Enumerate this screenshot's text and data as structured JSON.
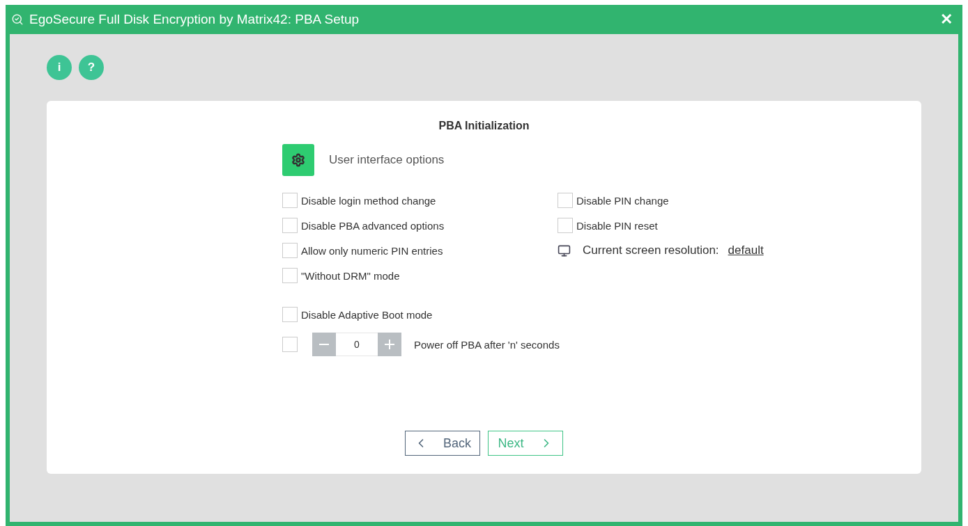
{
  "window": {
    "title": "EgoSecure Full Disk Encryption by Matrix42: PBA Setup",
    "close": "✕"
  },
  "header_buttons": [
    {
      "label": "i"
    },
    {
      "label": "?"
    }
  ],
  "page": {
    "title": "PBA Initialization",
    "section": "User interface options"
  },
  "left_options": [
    {
      "kind": "checkbox",
      "label": "Disable login method change",
      "checked": false
    },
    {
      "kind": "checkbox",
      "label": "Disable PBA advanced options",
      "checked": false
    },
    {
      "kind": "checkbox",
      "label": "Allow only numeric PIN entries",
      "checked": false
    },
    {
      "kind": "checkbox",
      "label": "\"Without DRM\" mode",
      "checked": false
    }
  ],
  "right_options": [
    {
      "kind": "checkbox",
      "label": "Disable PIN change",
      "checked": false
    },
    {
      "kind": "checkbox",
      "label": "Disable PIN reset",
      "checked": false
    },
    {
      "kind": "resolution",
      "label": "Current screen resolution:",
      "link": "default"
    }
  ],
  "boot_options": [
    {
      "kind": "checkbox",
      "label": "Disable Adaptive Boot mode",
      "checked": false
    },
    {
      "kind": "stepper",
      "label": "Power off PBA after 'n' seconds",
      "checked": false,
      "stepper": {
        "value": "0"
      }
    }
  ],
  "buttons": [
    {
      "kind": "back",
      "label": "Back"
    },
    {
      "kind": "next",
      "label": "Next"
    }
  ]
}
